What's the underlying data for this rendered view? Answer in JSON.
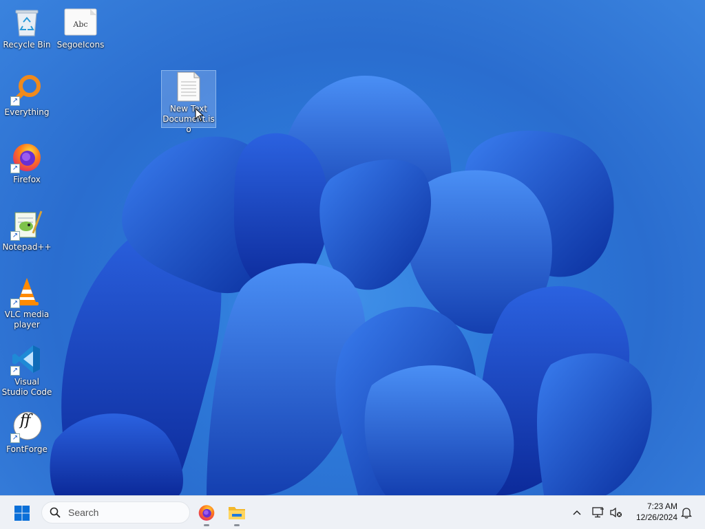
{
  "desktop": {
    "icons": [
      {
        "label": "Recycle Bin",
        "icon": "recycle-bin-icon",
        "shortcut": false
      },
      {
        "label": "SegoeIcons",
        "icon": "font-file-icon",
        "shortcut": false,
        "preview": "Abc"
      },
      {
        "label": "Everything",
        "icon": "everything-search-icon",
        "shortcut": true
      },
      {
        "label": "Firefox",
        "icon": "firefox-icon",
        "shortcut": true
      },
      {
        "label": "Notepad++",
        "icon": "notepad-plus-plus-icon",
        "shortcut": true
      },
      {
        "label": "VLC media player",
        "icon": "vlc-icon",
        "shortcut": true
      },
      {
        "label": "Visual Studio Code",
        "icon": "vscode-icon",
        "shortcut": true
      },
      {
        "label": "FontForge",
        "icon": "fontforge-icon",
        "shortcut": true,
        "preview": "ff"
      },
      {
        "label": "New Text Document.iso",
        "icon": "text-document-icon",
        "shortcut": false,
        "selected": true
      }
    ]
  },
  "taskbar": {
    "start_icon": "windows-start-icon",
    "search": {
      "placeholder": "Search",
      "value": ""
    },
    "pinned": [
      {
        "name": "Firefox",
        "icon": "firefox-icon",
        "running": true
      },
      {
        "name": "File Explorer",
        "icon": "file-explorer-icon",
        "running": true
      }
    ],
    "tray": {
      "chevron_icon": "chevron-up-icon",
      "network_icon": "network-disconnected-icon",
      "volume_icon": "volume-muted-icon",
      "notification_icon": "bell-icon"
    },
    "clock": {
      "time": "7:23 AM",
      "date": "12/26/2024"
    }
  },
  "colors": {
    "wallpaper_accent": "#1f5fd6",
    "taskbar_bg": "#eef1f6",
    "start_blue": "#0a6fd8"
  }
}
